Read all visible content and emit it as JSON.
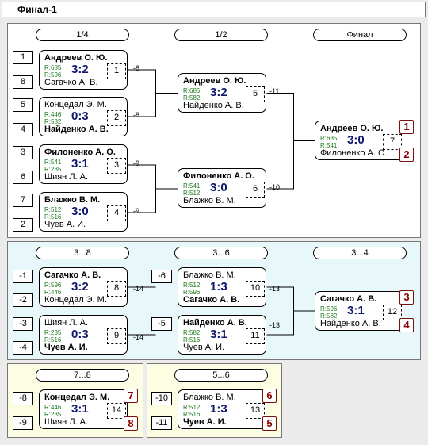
{
  "title": "Финал-1",
  "headers": {
    "main": [
      "1/4",
      "1/2",
      "Финал"
    ],
    "cons": [
      "3...8",
      "3...6",
      "3...4"
    ],
    "p78": [
      "7...8"
    ],
    "p56": [
      "5...6"
    ]
  },
  "seeds": {
    "main": [
      "1",
      "8",
      "5",
      "4",
      "3",
      "6",
      "7",
      "2"
    ],
    "cons": [
      "-1",
      "-2",
      "-3",
      "-4"
    ],
    "cons2": [
      "-6",
      "-5"
    ],
    "p78": [
      "-8",
      "-9"
    ],
    "p56": [
      "-10",
      "-11"
    ]
  },
  "matches": {
    "m1": {
      "p1": "Андреев О. Ю.",
      "p2": "Сагачко А. В.",
      "r1": "R:685",
      "r2": "R:596",
      "score": "3:2",
      "num": "1",
      "out": "-8"
    },
    "m2": {
      "p1": "Концедал Э. М.",
      "p2": "Найденко А. В.",
      "r1": "R:446",
      "r2": "R:582",
      "score": "0:3",
      "num": "2",
      "out": "-8"
    },
    "m3": {
      "p1": "Филоненко А. О.",
      "p2": "Шиян Л. А.",
      "r1": "R:541",
      "r2": "R:235",
      "score": "3:1",
      "num": "3",
      "out": "-9"
    },
    "m4": {
      "p1": "Блажко В. М.",
      "p2": "Чуев А. И.",
      "r1": "R:512",
      "r2": "R:516",
      "score": "3:0",
      "num": "4",
      "out": "-9"
    },
    "m5": {
      "p1": "Андреев О. Ю.",
      "p2": "Найденко А. В.",
      "r1": "R:685",
      "r2": "R:582",
      "score": "3:2",
      "num": "5",
      "out": "-11"
    },
    "m6": {
      "p1": "Филоненко А. О.",
      "p2": "Блажко В. М.",
      "r1": "R:541",
      "r2": "R:512",
      "score": "3:0",
      "num": "6",
      "out": "-10"
    },
    "m7": {
      "p1": "Андреев О. Ю.",
      "p2": "Филоненко А. О.",
      "r1": "R:685",
      "r2": "R:541",
      "score": "3:0",
      "num": "7",
      "place1": "1",
      "place2": "2"
    },
    "m8": {
      "p1": "Сагачко А. В.",
      "p2": "Концедал Э. М.",
      "r1": "R:596",
      "r2": "R:446",
      "score": "3:2",
      "num": "8",
      "out": "-14"
    },
    "m9": {
      "p1": "Шиян Л. А.",
      "p2": "Чуев А. И.",
      "r1": "R:235",
      "r2": "R:516",
      "score": "0:3",
      "num": "9",
      "out": "-14"
    },
    "m10": {
      "p1": "Блажко В. М.",
      "p2": "Сагачко А. В.",
      "r1": "R:512",
      "r2": "R:596",
      "score": "1:3",
      "num": "10",
      "out": "-13"
    },
    "m11": {
      "p1": "Найденко А. В.",
      "p2": "Чуев А. И.",
      "r1": "R:582",
      "r2": "R:516",
      "score": "3:1",
      "num": "11",
      "out": "-13"
    },
    "m12": {
      "p1": "Сагачко А. В.",
      "p2": "Найденко А. В.",
      "r1": "R:596",
      "r2": "R:582",
      "score": "3:1",
      "num": "12",
      "place1": "3",
      "place2": "4"
    },
    "m14": {
      "p1": "Концедал Э. М.",
      "p2": "Шиян Л. А.",
      "r1": "R:446",
      "r2": "R:235",
      "score": "3:1",
      "num": "14",
      "place1": "7",
      "place2": "8"
    },
    "m13": {
      "p1": "Блажко В. М.",
      "p2": "Чуев А. И.",
      "r1": "R:512",
      "r2": "R:516",
      "score": "1:3",
      "num": "13",
      "place1": "6",
      "place2": "5"
    }
  },
  "colors": {
    "main_bg": "#ffffff",
    "cons_bg": "#e8f8fa",
    "place_bg": "#fdfde4",
    "score": "#0f1a6e",
    "rating": "#1d7a1d",
    "place": "#8b0000"
  }
}
